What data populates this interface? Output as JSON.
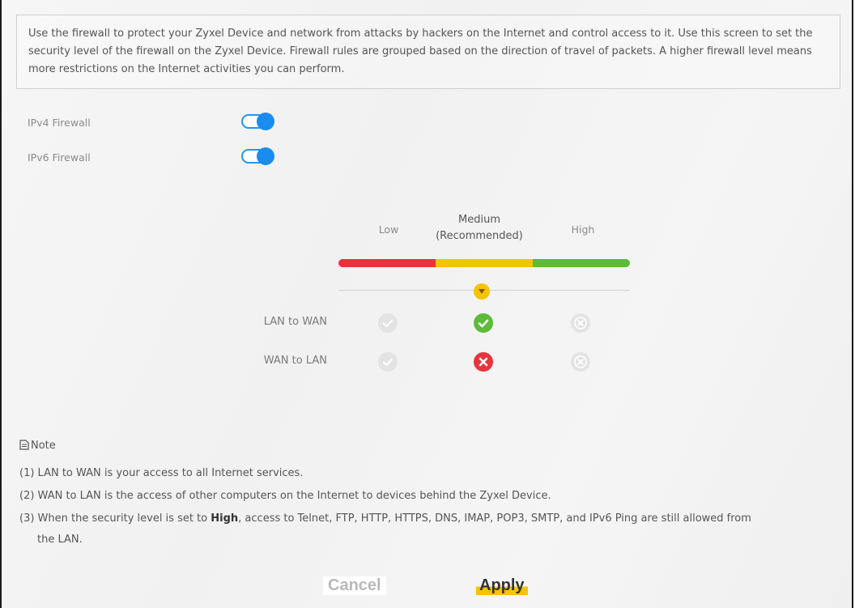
{
  "intro": {
    "text": "Use the firewall to protect your Zyxel Device and network from attacks by hackers on the Internet and control access to it. Use this screen to set the security level of the firewall on the Zyxel Device. Firewall rules are grouped based on the direction of travel of packets. A higher firewall level means more restrictions on the Internet activities you can perform."
  },
  "toggles": {
    "ipv4": {
      "label": "IPv4 Firewall",
      "state": "on"
    },
    "ipv6": {
      "label": "IPv6 Firewall",
      "state": "on"
    }
  },
  "levels": {
    "low": "Low",
    "medium_line1": "Medium",
    "medium_line2": "(Recommended)",
    "high": "High",
    "selected": "Medium",
    "colors": {
      "low": "#e8343c",
      "medium": "#f5c400",
      "high": "#5cbb3a"
    }
  },
  "matrix": {
    "rows": [
      {
        "label": "LAN to WAN",
        "low": "check-grey",
        "medium": "check-green",
        "high": "x-grey"
      },
      {
        "label": "WAN to LAN",
        "low": "check-grey",
        "medium": "x-red",
        "high": "x-grey"
      }
    ]
  },
  "note": {
    "title": "Note",
    "line1": "(1) LAN to WAN is your access to all Internet services.",
    "line2": "(2) WAN to LAN is the access of other computers on the Internet to devices behind the Zyxel Device.",
    "line3_pre": "(3) When the security level is set to ",
    "line3_bold": "High",
    "line3_post": ", access to Telnet, FTP, HTTP, HTTPS, DNS, IMAP, POP3, SMTP, and IPv6 Ping are still allowed from",
    "line4": "the LAN."
  },
  "buttons": {
    "cancel": "Cancel",
    "apply": "Apply"
  }
}
